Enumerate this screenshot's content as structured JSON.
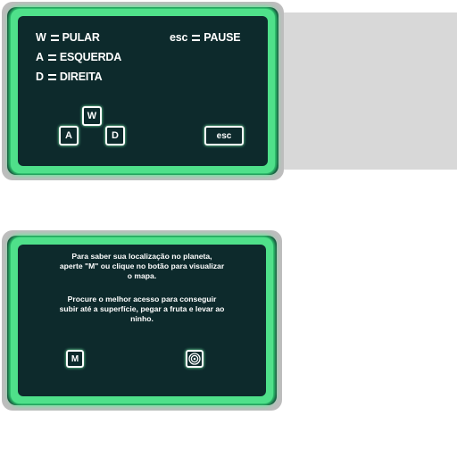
{
  "controls": {
    "jump": {
      "key": "W",
      "action": "PULAR"
    },
    "left": {
      "key": "A",
      "action": "ESQUERDA"
    },
    "right": {
      "key": "D",
      "action": "DIREITA"
    },
    "pause": {
      "key": "esc",
      "action": "PAUSE"
    }
  },
  "keycaps": {
    "w": "W",
    "a": "A",
    "d": "D",
    "esc": "esc"
  },
  "help": {
    "line1": "Para saber sua localização no planeta,",
    "line2": "aperte \"M\" ou clique no botão para visualizar",
    "line3": "o mapa.",
    "line4": "Procure o melhor acesso para conseguir",
    "line5": "subir até a superfície, pegar a fruta e levar ao",
    "line6": "ninho.",
    "map_key": "M",
    "map_button_icon": "target-icon"
  },
  "colors": {
    "frame_green": "#4fe08a",
    "panel_dark": "#0d2a2c",
    "outer_grey": "#bdbdbd",
    "text": "#ffffff"
  }
}
